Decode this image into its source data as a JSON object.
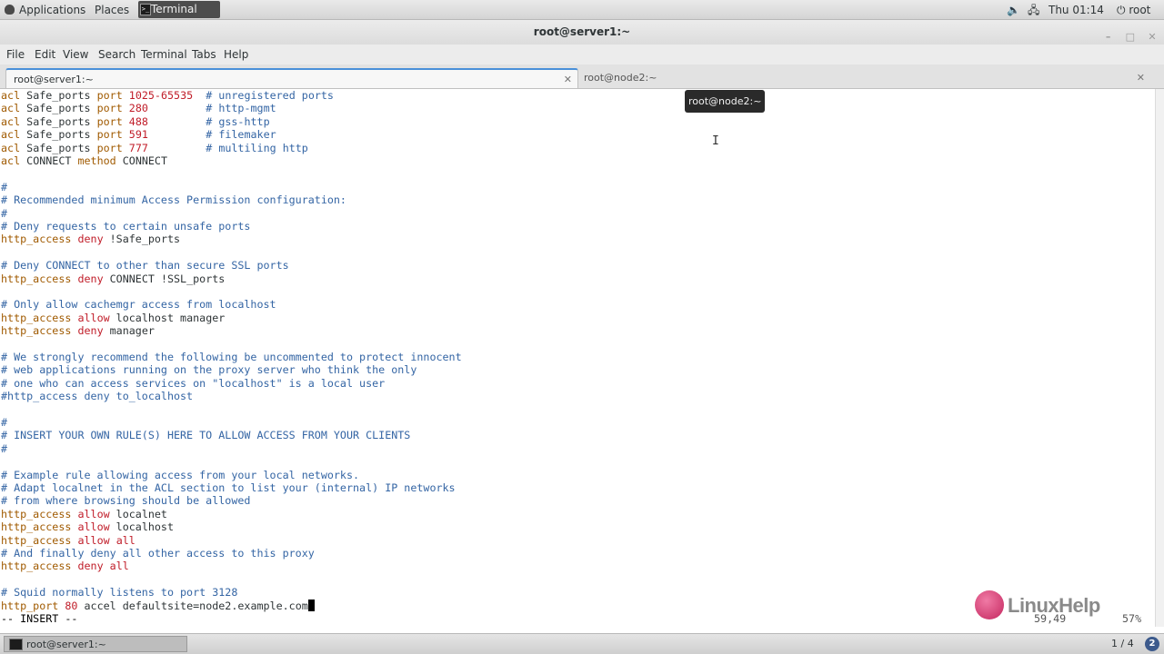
{
  "top_panel": {
    "applications": "Applications",
    "places": "Places",
    "task": "Terminal",
    "task_icon": ">_",
    "volume_icon": "🔈",
    "network_icon": "🖧",
    "clock": "Thu 01:14",
    "user_icon": "⏻",
    "user": "root"
  },
  "window": {
    "title": "root@server1:~",
    "minimize": "–",
    "maximize": "□",
    "close": "✕"
  },
  "menu": {
    "file": "File",
    "edit": "Edit",
    "view": "View",
    "search": "Search",
    "terminal": "Terminal",
    "tabs": "Tabs",
    "help": "Help"
  },
  "tabs": [
    {
      "label": "root@server1:~",
      "close": "✕",
      "active": true
    },
    {
      "label": "root@node2:~",
      "close": "✕",
      "active": false
    }
  ],
  "tooltip": "root@node2:~",
  "ibeam": "I",
  "terminal_lines": [
    [
      [
        "acl",
        "kw"
      ],
      [
        " Safe_ports ",
        ""
      ],
      [
        "port",
        "kw"
      ],
      [
        " ",
        ""
      ],
      [
        "1025-65535",
        "num"
      ],
      [
        "  ",
        ""
      ],
      [
        "# unregistered ports",
        "cmt"
      ]
    ],
    [
      [
        "acl",
        "kw"
      ],
      [
        " Safe_ports ",
        ""
      ],
      [
        "port",
        "kw"
      ],
      [
        " ",
        ""
      ],
      [
        "280",
        "num"
      ],
      [
        "         ",
        ""
      ],
      [
        "# http-mgmt",
        "cmt"
      ]
    ],
    [
      [
        "acl",
        "kw"
      ],
      [
        " Safe_ports ",
        ""
      ],
      [
        "port",
        "kw"
      ],
      [
        " ",
        ""
      ],
      [
        "488",
        "num"
      ],
      [
        "         ",
        ""
      ],
      [
        "# gss-http",
        "cmt"
      ]
    ],
    [
      [
        "acl",
        "kw"
      ],
      [
        " Safe_ports ",
        ""
      ],
      [
        "port",
        "kw"
      ],
      [
        " ",
        ""
      ],
      [
        "591",
        "num"
      ],
      [
        "         ",
        ""
      ],
      [
        "# filemaker",
        "cmt"
      ]
    ],
    [
      [
        "acl",
        "kw"
      ],
      [
        " Safe_ports ",
        ""
      ],
      [
        "port",
        "kw"
      ],
      [
        " ",
        ""
      ],
      [
        "777",
        "num"
      ],
      [
        "         ",
        ""
      ],
      [
        "# multiling http",
        "cmt"
      ]
    ],
    [
      [
        "acl",
        "kw"
      ],
      [
        " CONNECT ",
        ""
      ],
      [
        "method",
        "kw"
      ],
      [
        " CONNECT",
        ""
      ]
    ],
    [],
    [
      [
        "#",
        "cmt"
      ]
    ],
    [
      [
        "# Recommended minimum Access Permission configuration:",
        "cmt"
      ]
    ],
    [
      [
        "#",
        "cmt"
      ]
    ],
    [
      [
        "# Deny requests to certain unsafe ports",
        "cmt"
      ]
    ],
    [
      [
        "http_access",
        "kw"
      ],
      [
        " ",
        ""
      ],
      [
        "deny",
        "act"
      ],
      [
        " !Safe_ports",
        ""
      ]
    ],
    [],
    [
      [
        "# Deny CONNECT to other than secure SSL ports",
        "cmt"
      ]
    ],
    [
      [
        "http_access",
        "kw"
      ],
      [
        " ",
        ""
      ],
      [
        "deny",
        "act"
      ],
      [
        " CONNECT !SSL_ports",
        ""
      ]
    ],
    [],
    [
      [
        "# Only allow cachemgr access from localhost",
        "cmt"
      ]
    ],
    [
      [
        "http_access",
        "kw"
      ],
      [
        " ",
        ""
      ],
      [
        "allow",
        "act"
      ],
      [
        " localhost manager",
        ""
      ]
    ],
    [
      [
        "http_access",
        "kw"
      ],
      [
        " ",
        ""
      ],
      [
        "deny",
        "act"
      ],
      [
        " manager",
        ""
      ]
    ],
    [],
    [
      [
        "# We strongly recommend the following be uncommented to protect innocent",
        "cmt"
      ]
    ],
    [
      [
        "# web applications running on the proxy server who think the only",
        "cmt"
      ]
    ],
    [
      [
        "# one who can access services on \"localhost\" is a local user",
        "cmt"
      ]
    ],
    [
      [
        "#http_access deny to_localhost",
        "cmt"
      ]
    ],
    [],
    [
      [
        "#",
        "cmt"
      ]
    ],
    [
      [
        "# INSERT YOUR OWN RULE(S) HERE TO ALLOW ACCESS FROM YOUR CLIENTS",
        "cmt"
      ]
    ],
    [
      [
        "#",
        "cmt"
      ]
    ],
    [],
    [
      [
        "# Example rule allowing access from your local networks.",
        "cmt"
      ]
    ],
    [
      [
        "# Adapt localnet in the ACL section to list your (internal) IP networks",
        "cmt"
      ]
    ],
    [
      [
        "# from where browsing should be allowed",
        "cmt"
      ]
    ],
    [
      [
        "http_access",
        "kw"
      ],
      [
        " ",
        ""
      ],
      [
        "allow",
        "act"
      ],
      [
        " localnet",
        ""
      ]
    ],
    [
      [
        "http_access",
        "kw"
      ],
      [
        " ",
        ""
      ],
      [
        "allow",
        "act"
      ],
      [
        " localhost",
        ""
      ]
    ],
    [
      [
        "http_access",
        "kw"
      ],
      [
        " ",
        ""
      ],
      [
        "allow",
        "act"
      ],
      [
        " ",
        ""
      ],
      [
        "all",
        "act"
      ]
    ],
    [
      [
        "# And finally deny all other access to this proxy",
        "cmt"
      ]
    ],
    [
      [
        "http_access",
        "kw"
      ],
      [
        " ",
        ""
      ],
      [
        "deny",
        "act"
      ],
      [
        " ",
        ""
      ],
      [
        "all",
        "act"
      ]
    ],
    [],
    [
      [
        "# Squid normally listens to port 3128",
        "cmt"
      ]
    ],
    [
      [
        "http_port",
        "kw"
      ],
      [
        " ",
        ""
      ],
      [
        "80",
        "num"
      ],
      [
        " accel defaultsite=node2.example.com",
        ""
      ]
    ]
  ],
  "status": {
    "mode": "-- INSERT --",
    "position": "59,49",
    "percent": "57%"
  },
  "watermark": "LinuxHelp",
  "bottom_panel": {
    "task": "root@server1:~",
    "workspace": "1 / 4",
    "badge": "2"
  }
}
